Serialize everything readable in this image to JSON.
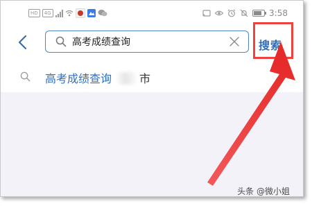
{
  "status_bar": {
    "left_chips": [
      "HD",
      "4G"
    ],
    "time": "3:58",
    "icons": [
      "signal-icon",
      "wifi-icon",
      "app-notification-icon",
      "app-notification-icon-2",
      "chat-notification-icon",
      "cast-icon",
      "eye-icon",
      "alarm-icon",
      "mute-icon",
      "battery-icon"
    ]
  },
  "search": {
    "query": "高考成绩查询",
    "action_label": "搜索"
  },
  "suggestion": {
    "highlight": "高考成绩查询",
    "suffix": "市"
  },
  "annotation": {
    "highlight_color": "#f04141"
  },
  "watermark": {
    "text": "头条 @微小姐"
  },
  "colors": {
    "accent": "#2f6fbd",
    "search_border": "#4d85c7",
    "background": "#f3f2f8"
  }
}
